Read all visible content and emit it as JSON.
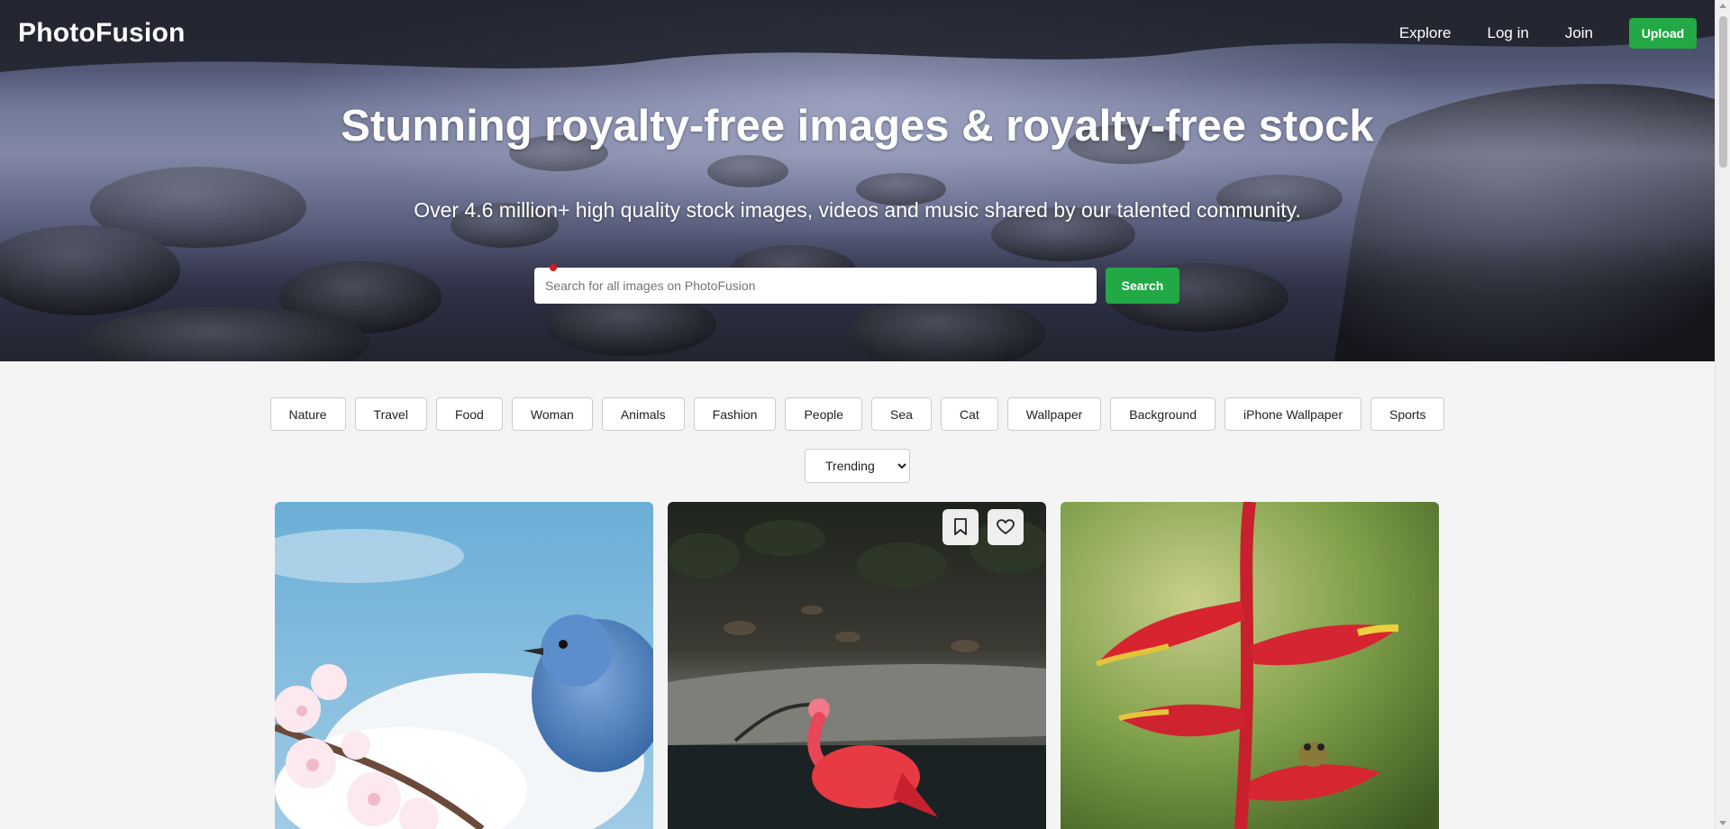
{
  "brand": {
    "name": "PhotoFusion"
  },
  "nav": {
    "explore": "Explore",
    "login": "Log in",
    "join": "Join",
    "upload": "Upload"
  },
  "hero": {
    "title": "Stunning royalty-free images & royalty-free stock",
    "subtitle": "Over 4.6 million+ high quality stock images, videos and music shared by our talented community.",
    "search_placeholder": "Search for all images on PhotoFusion",
    "search_button": "Search"
  },
  "tags": [
    "Nature",
    "Travel",
    "Food",
    "Woman",
    "Animals",
    "Fashion",
    "People",
    "Sea",
    "Cat",
    "Wallpaper",
    "Background",
    "iPhone Wallpaper",
    "Sports"
  ],
  "sort": {
    "selected": "Trending"
  },
  "gallery": [
    {
      "subject": "blue bird on cherry blossom branch"
    },
    {
      "subject": "scarlet ibis wading in water",
      "actions": [
        "bookmark-icon",
        "heart-icon"
      ]
    },
    {
      "subject": "frog on red heliconia flower"
    }
  ],
  "colors": {
    "accent": "#22a845",
    "page_bg": "#f4f4f4"
  }
}
